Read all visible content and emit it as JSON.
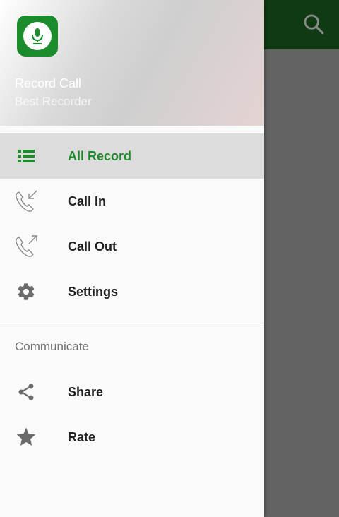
{
  "header": {
    "title": "Record Call",
    "subtitle": "Best Recorder"
  },
  "menu": {
    "items": [
      {
        "label": "All Record",
        "icon": "list-icon"
      },
      {
        "label": "Call In",
        "icon": "call-incoming-icon"
      },
      {
        "label": "Call Out",
        "icon": "call-outgoing-icon"
      },
      {
        "label": "Settings",
        "icon": "gear-icon"
      }
    ]
  },
  "section": {
    "label": "Communicate",
    "items": [
      {
        "label": "Share",
        "icon": "share-icon"
      },
      {
        "label": "Rate",
        "icon": "star-icon"
      }
    ]
  },
  "colors": {
    "accent": "#1f8a2c",
    "toolbar": "#0f3a12"
  }
}
